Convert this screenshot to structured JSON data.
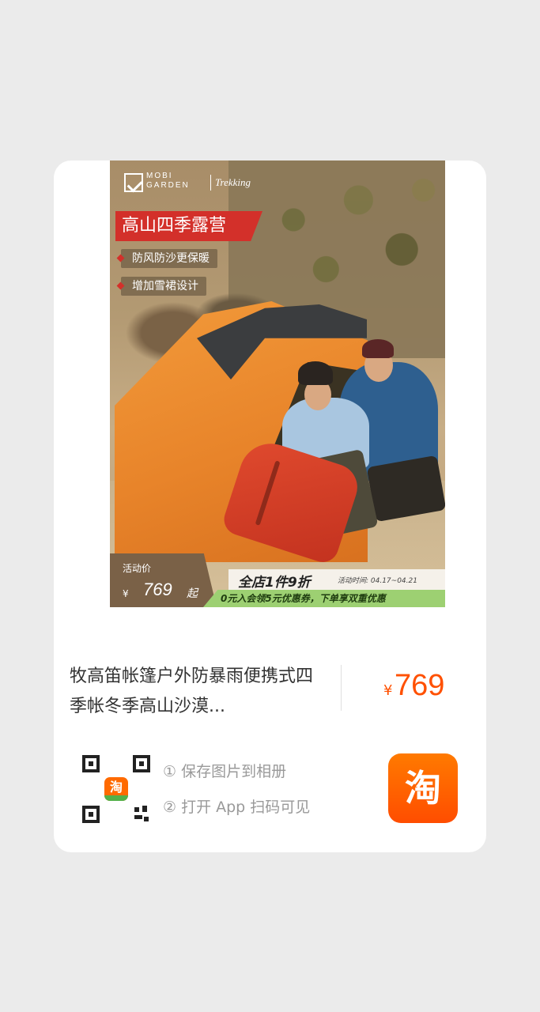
{
  "poster": {
    "product_image": {
      "brand_name": "MOBI\nGARDEN",
      "brand_sub": "Trekking",
      "headline": "高山四季露营",
      "features": [
        "防风防沙更保暖",
        "增加雪裙设计"
      ],
      "activity_label": "活动价",
      "activity_currency": "¥",
      "activity_price": "769",
      "activity_suffix": "起",
      "promo_main": "全店1件9折",
      "promo_date": "活动时间: 04.17~04.21",
      "promo_coupon": "0元入会领5元优惠券，下单享双重优惠"
    },
    "product_title": "牧高笛帐篷户外防暴雨便携式四季帐冬季高山沙漠...",
    "price": {
      "currency": "¥",
      "value": "769"
    },
    "share": {
      "qr_logo_char": "淘",
      "steps": [
        "① 保存图片到相册",
        "② 打开 App 扫码可见"
      ],
      "app_icon_char": "淘"
    }
  },
  "colors": {
    "price_accent": "#ff5000",
    "headline_red": "#d3302a",
    "taobao_orange": "#ff5a00",
    "background": "#ebebeb"
  }
}
